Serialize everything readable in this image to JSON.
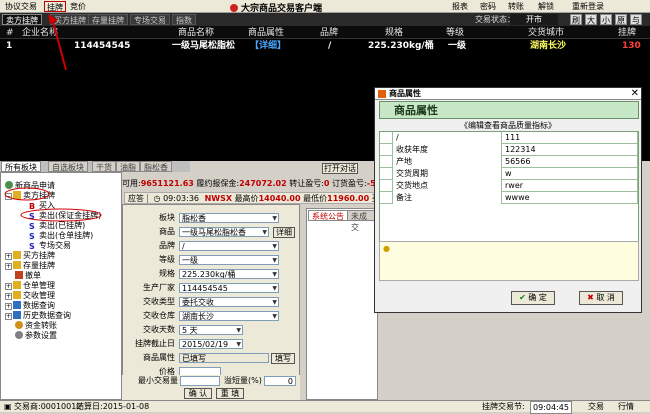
{
  "menu": {
    "items": [
      "协议交易",
      "挂牌",
      "竞价"
    ],
    "active": "挂牌",
    "app_title": "大宗商品交易客户端",
    "right_items": [
      "报表",
      "密码",
      "转账",
      "解锁",
      "重新登录"
    ]
  },
  "tabs": [
    "卖方挂牌",
    "买方挂牌",
    "存量挂牌",
    "专场交易",
    "指数"
  ],
  "trade_state": {
    "label": "交易状态：",
    "value": "开市"
  },
  "small_buttons": [
    "刷",
    "大",
    "小",
    "原",
    "与"
  ],
  "market": {
    "headers": [
      "#",
      "企业名称",
      "商品名称",
      "商品属性",
      "品牌",
      "规格",
      "等级",
      "交货城市",
      "挂牌"
    ],
    "row": {
      "index": "1",
      "company": "114454545",
      "product": "一级马尾松脂松",
      "attr": "【详细】",
      "brand": "/",
      "spec": "225.230kg/桶",
      "grade": "一级",
      "city": "湖南长沙",
      "qty": "130"
    }
  },
  "left_tabs": [
    "所有板块",
    "自选板块",
    "干货",
    "油脂",
    "脂松香"
  ],
  "tree": {
    "items": [
      "新商品申请",
      "卖方挂牌",
      "买入",
      "卖出(保证金挂牌)",
      "卖出(已挂牌)",
      "卖出(仓单挂牌)",
      "专场交易",
      "买方挂牌",
      "存量挂牌",
      "撤单",
      "仓单管理",
      "交收管理",
      "数据查询",
      "历史数据查询",
      "资金转账",
      "参数设置"
    ]
  },
  "info": {
    "available_label": "可用:",
    "available": "9651121.63",
    "deposit_label": "履约报保金:",
    "deposit": "247072.02",
    "transfer_label": "转让盈亏:",
    "transfer": "0",
    "order_label": "订货盈亏:",
    "order": "-531"
  },
  "price_strip": {
    "tab": "应答",
    "time": "09:03:36",
    "code": "NWSX",
    "high_label": "最高价",
    "high": "14040.00",
    "low_label": "最低价",
    "low": "11960.00",
    "buy_label": "买"
  },
  "form": {
    "fields": [
      {
        "label": "板块",
        "value": "脂松香"
      },
      {
        "label": "商品",
        "value": "一级马尾松脂松香"
      },
      {
        "label": "品牌",
        "value": "/"
      },
      {
        "label": "等级",
        "value": "一级"
      },
      {
        "label": "规格",
        "value": "225.230kg/桶"
      },
      {
        "label": "生产厂家",
        "value": "114454545"
      },
      {
        "label": "交收类型",
        "value": "委托交收"
      },
      {
        "label": "交收仓库",
        "value": "湖南长沙"
      },
      {
        "label": "交收天数",
        "value": "5 天"
      },
      {
        "label": "挂牌截止日",
        "value": "2015/02/19"
      },
      {
        "label": "商品属性",
        "value": "已填写"
      },
      {
        "label": "价格",
        "value": ""
      },
      {
        "label": "数量",
        "value": ""
      }
    ],
    "detail_btn": "详细",
    "fill_btn": "填写",
    "min_qty_label": "最小交易量",
    "overflow_label": "溢短量(%)",
    "overflow_value": "0",
    "confirm_btn": "确 认",
    "reset_btn": "重 填"
  },
  "notice_tabs": [
    "系统公告",
    "未成交"
  ],
  "open_btn": "打开对话",
  "bottom": {
    "trader": "交易商:00010012",
    "settle": "结算日:2015-01-08",
    "section": "挂牌交易节: ",
    "time": "09:04:45",
    "right1": "交易",
    "right2": "行情"
  },
  "dialog": {
    "title": "商品属性",
    "header": "商品属性",
    "hint": "《编辑查看商品质量指标》",
    "rows": [
      {
        "k": "/",
        "v": "111"
      },
      {
        "k": "收获年度",
        "v": "122314"
      },
      {
        "k": "产地",
        "v": "56566"
      },
      {
        "k": "交货周期",
        "v": "w"
      },
      {
        "k": "交货地点",
        "v": "rwer"
      },
      {
        "k": "备注",
        "v": "wwwe"
      }
    ],
    "ok": "确 定",
    "cancel": "取 消",
    "ok_icon": "check-icon",
    "cancel_icon": "x-icon"
  },
  "colors": {
    "accent_red": "#c00000",
    "market_bg": "#000000",
    "grid_green": "#c7e8c7"
  }
}
